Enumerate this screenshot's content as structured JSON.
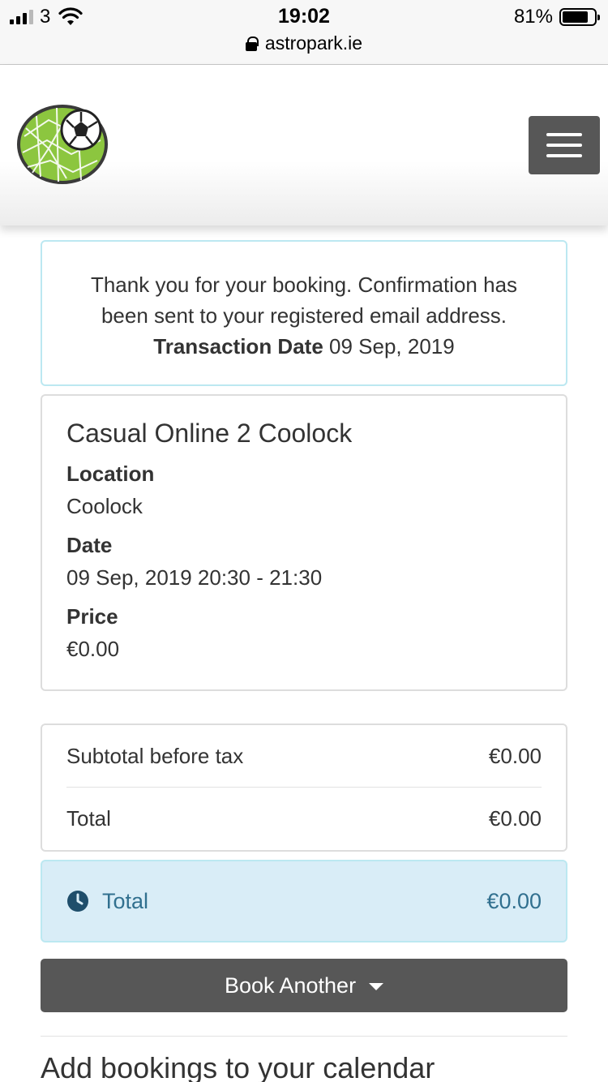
{
  "status_bar": {
    "carrier": "3",
    "time": "19:02",
    "url": "astropark.ie",
    "battery_percent": "81%",
    "battery_level": 0.81,
    "icons": [
      "signal-icon",
      "wifi-icon",
      "lock-icon",
      "battery-icon"
    ]
  },
  "header": {
    "logo_icon": "soccer-ball-net-logo",
    "menu_icon": "hamburger-menu-icon"
  },
  "alert": {
    "line1": "Thank you for your booking. Confirmation has",
    "line2": "been sent to your registered email address.",
    "transaction_label": "Transaction Date",
    "transaction_date": "09 Sep, 2019"
  },
  "booking": {
    "title": "Casual Online 2 Coolock",
    "location_label": "Location",
    "location_value": "Coolock",
    "date_label": "Date",
    "date_value": "09 Sep, 2019 20:30 - 21:30",
    "price_label": "Price",
    "price_value": "€0.00"
  },
  "totals": {
    "subtotal_label": "Subtotal before tax",
    "subtotal_value": "€0.00",
    "total_label": "Total",
    "total_value": "€0.00"
  },
  "info_total": {
    "icon": "clock-icon",
    "label": "Total",
    "value": "€0.00"
  },
  "actions": {
    "book_another_label": "Book Another"
  },
  "calendar": {
    "heading": "Add bookings to your calendar"
  },
  "colors": {
    "info_bg": "#d9edf7",
    "info_border": "#bce8f1",
    "info_text": "#31708f",
    "button_bg": "#575757"
  }
}
